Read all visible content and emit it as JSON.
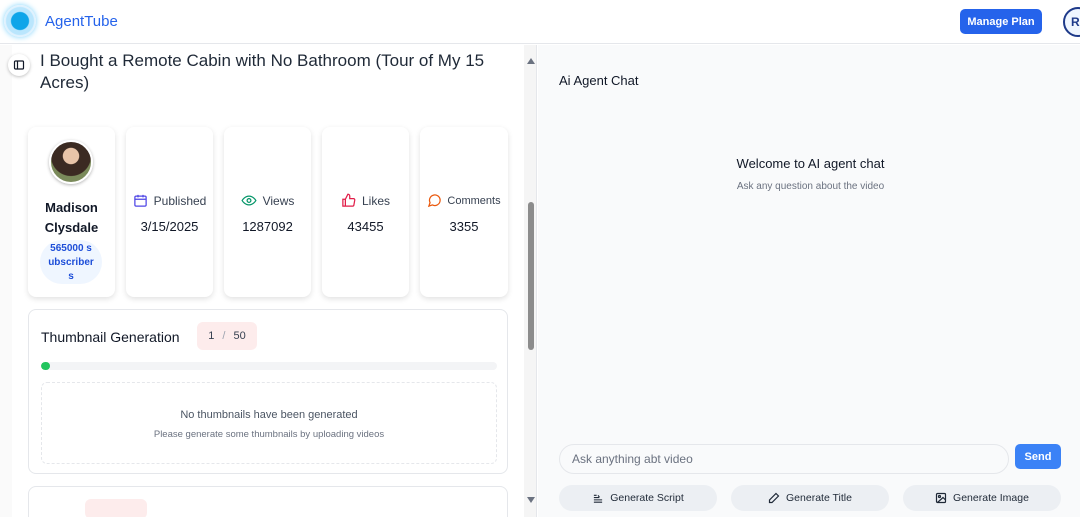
{
  "app": {
    "brand": "AgentTube",
    "manage_plan_label": "Manage Plan",
    "user_initial": "R"
  },
  "video": {
    "title": "I Bought a Remote Cabin with No Bathroom (Tour of My 15 Acres)",
    "channel_name": "Madison Clysdale",
    "subscribers": "565000 subscribers"
  },
  "stats": [
    {
      "label": "Published",
      "value": "3/15/2025",
      "icon": "calendar-icon",
      "color": "#4f46e5"
    },
    {
      "label": "Views",
      "value": "1287092",
      "icon": "eye-icon",
      "color": "#059669"
    },
    {
      "label": "Likes",
      "value": "43455",
      "icon": "thumbs-up-icon",
      "color": "#e11d48"
    },
    {
      "label": "Comments",
      "value": "3355",
      "icon": "message-circle-icon",
      "color": "#ea580c"
    }
  ],
  "thumbnails": {
    "title": "Thumbnail Generation",
    "used": "1",
    "limit": "50",
    "progress_fraction": 0.02,
    "empty_title": "No thumbnails have been generated",
    "empty_subtitle": "Please generate some thumbnails by uploading videos"
  },
  "chat": {
    "heading": "Ai Agent Chat",
    "welcome_title": "Welcome to AI agent chat",
    "welcome_subtitle": "Ask any question about the video",
    "input_placeholder": "Ask anything abt video",
    "send_label": "Send",
    "actions": [
      {
        "label": "Generate Script",
        "icon": "script-icon"
      },
      {
        "label": "Generate Title",
        "icon": "pencil-icon"
      },
      {
        "label": "Generate Image",
        "icon": "image-icon"
      }
    ]
  }
}
